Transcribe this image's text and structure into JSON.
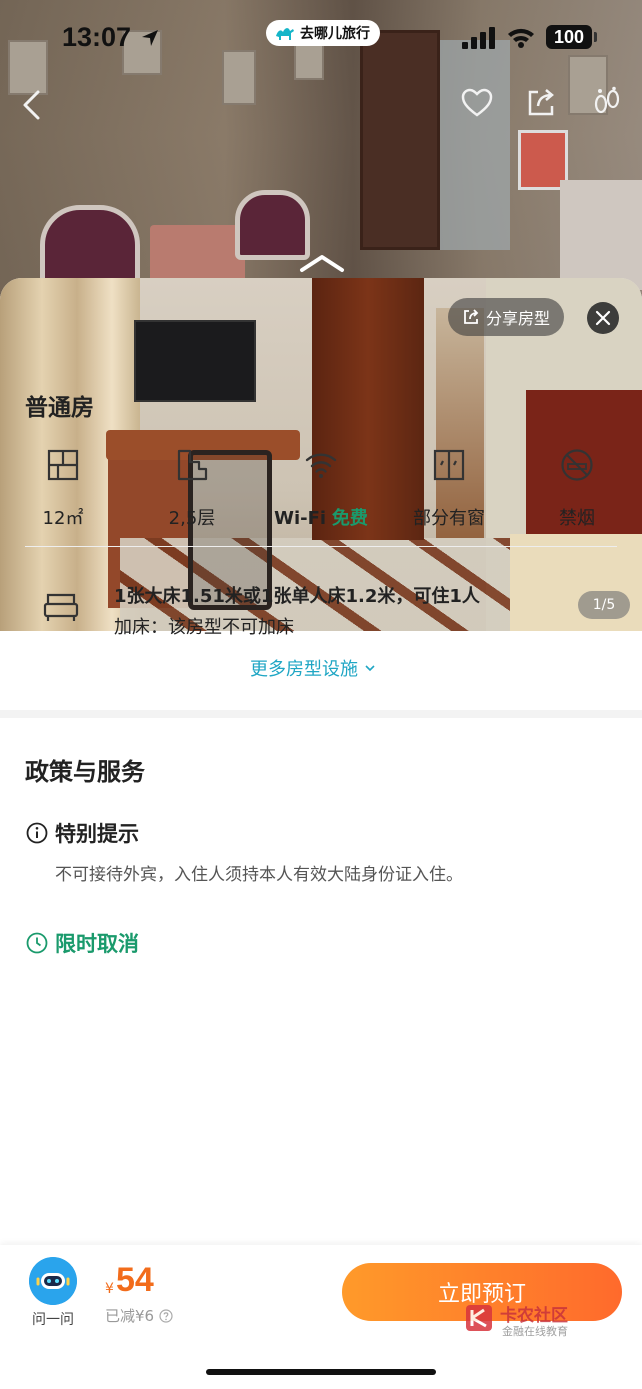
{
  "status_bar": {
    "time": "13:07",
    "battery": "100",
    "app_pill": "去哪儿旅行"
  },
  "gallery": {
    "share_label": "分享房型",
    "counter": "1/5"
  },
  "room": {
    "name": "普通房",
    "features": [
      {
        "icon": "area-icon",
        "label": "12㎡"
      },
      {
        "icon": "floor-icon",
        "label": "2,5层"
      },
      {
        "icon": "wifi-icon",
        "label": "Wi-Fi",
        "accent": "免费"
      },
      {
        "icon": "window-icon",
        "label": "部分有窗"
      },
      {
        "icon": "no-smoking-icon",
        "label": "禁烟"
      }
    ],
    "bed_info": "1张大床1.51米或1张单人床1.2米，可住1人",
    "extra_bed": "加床：该房型不可加床",
    "more_facilities": "更多房型设施"
  },
  "policy": {
    "title": "政策与服务",
    "notice_title": "特别提示",
    "notice_text": "不可接待外宾，入住人须持本人有效大陆身份证入住。",
    "cancel_title": "限时取消"
  },
  "bottom": {
    "ask_label": "问一问",
    "currency": "¥",
    "price": "54",
    "discount": "已减¥6",
    "book_label": "立即预订",
    "watermark_title": "卡农社区",
    "watermark_sub": "金融在线教育"
  },
  "colors": {
    "accent_green": "#1a9a6c",
    "link_blue": "#1fa6c4",
    "price_orange": "#f26c1b",
    "button_orange": "#ff7a2b"
  }
}
